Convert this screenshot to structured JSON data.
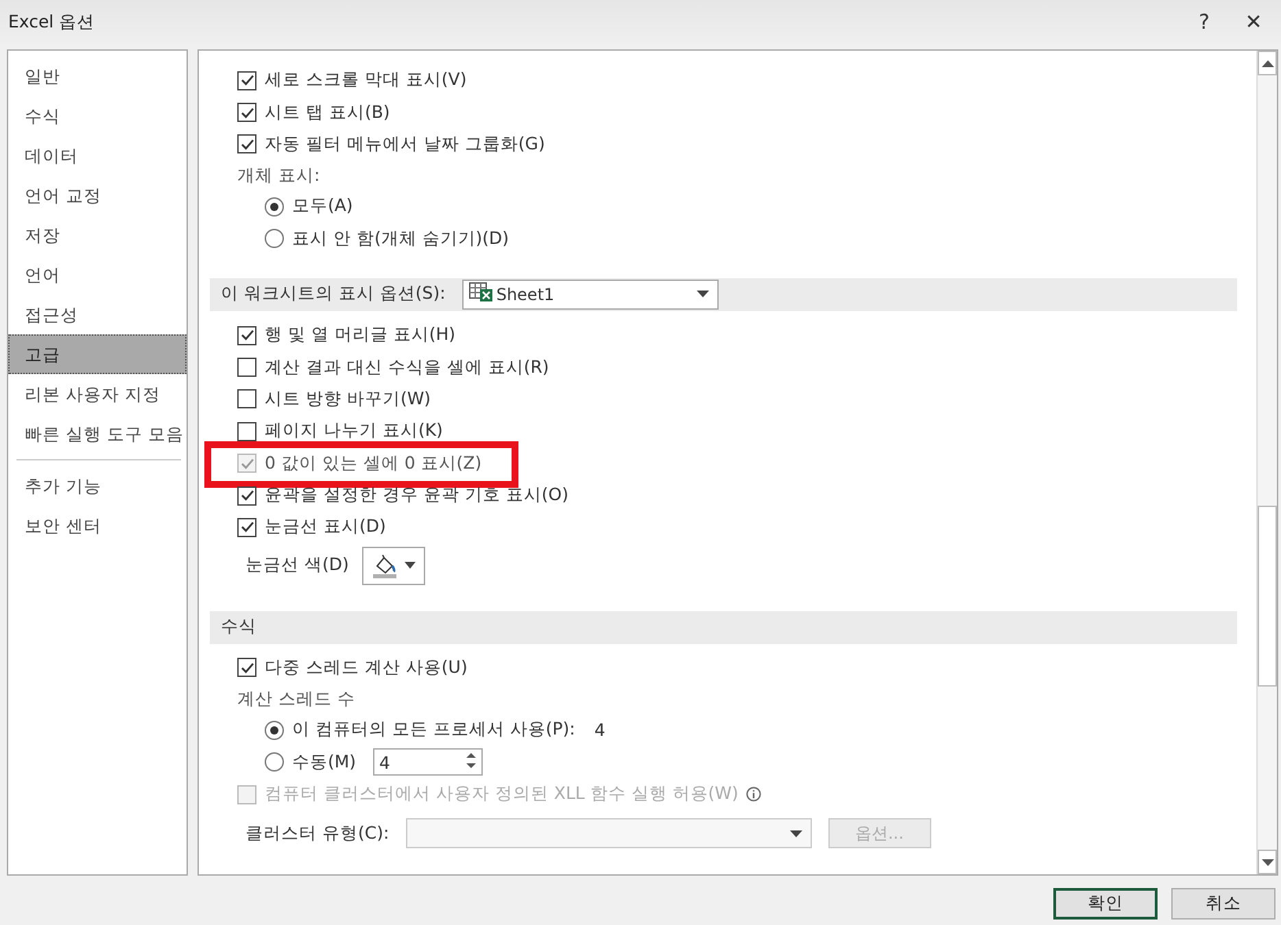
{
  "window": {
    "title": "Excel 옵션",
    "help": "?",
    "close": "✕"
  },
  "sidebar": {
    "items": [
      {
        "label": "일반",
        "selected": false
      },
      {
        "label": "수식",
        "selected": false
      },
      {
        "label": "데이터",
        "selected": false
      },
      {
        "label": "언어 교정",
        "selected": false
      },
      {
        "label": "저장",
        "selected": false
      },
      {
        "label": "언어",
        "selected": false
      },
      {
        "label": "접근성",
        "selected": false
      },
      {
        "label": "고급",
        "selected": true
      },
      {
        "label": "리본 사용자 지정",
        "selected": false,
        "separator_after": false
      },
      {
        "label": "빠른 실행 도구 모음",
        "selected": false,
        "separator_after": true
      },
      {
        "label": "추가 기능",
        "selected": false
      },
      {
        "label": "보안 센터",
        "selected": false
      }
    ]
  },
  "content": {
    "items": [
      {
        "kind": "checkbox",
        "label": "세로 스크롤 막대 표시(V)",
        "checked": true,
        "disabled": false
      },
      {
        "kind": "checkbox",
        "label": "시트 탭 표시(B)",
        "checked": true,
        "disabled": false
      },
      {
        "kind": "checkbox",
        "label": "자동 필터 메뉴에서 날짜 그룹화(G)",
        "checked": true,
        "disabled": false
      },
      {
        "kind": "group",
        "label": "개체 표시:",
        "children": [
          {
            "kind": "radio",
            "label": "모두(A)",
            "selected": true
          },
          {
            "kind": "radio",
            "label": "표시 안 함(개체 숨기기)(D)",
            "selected": false
          }
        ]
      },
      {
        "kind": "section",
        "label": "이 워크시트의 표시 옵션(S):",
        "dropdown": "Sheet1"
      },
      {
        "kind": "checkbox",
        "label": "행 및 열 머리글 표시(H)",
        "checked": true,
        "disabled": false
      },
      {
        "kind": "checkbox",
        "label": "계산 결과 대신 수식을 셀에 표시(R)",
        "checked": false,
        "disabled": false
      },
      {
        "kind": "checkbox",
        "label": "시트 방향 바꾸기(W)",
        "checked": false,
        "disabled": false
      },
      {
        "kind": "checkbox",
        "label": "페이지 나누기 표시(K)",
        "checked": false,
        "disabled": false
      },
      {
        "kind": "checkbox",
        "label": "0 값이 있는 셀에 0 표시(Z)",
        "checked": true,
        "disabled": true,
        "highlighted": true
      },
      {
        "kind": "checkbox",
        "label": "윤곽을 설정한 경우 윤곽 기호 표시(O)",
        "checked": true,
        "disabled": false
      },
      {
        "kind": "checkbox",
        "label": "눈금선 표시(D)",
        "checked": true,
        "disabled": false
      },
      {
        "kind": "color",
        "label": "눈금선 색(D)"
      },
      {
        "kind": "section",
        "label": "수식"
      },
      {
        "kind": "checkbox",
        "label": "다중 스레드 계산 사용(U)",
        "checked": true,
        "disabled": false
      },
      {
        "kind": "group",
        "label": "계산 스레드 수",
        "children": [
          {
            "kind": "radio",
            "label": "이 컴퓨터의 모든 프로세서 사용(P):",
            "selected": true,
            "count": "4"
          },
          {
            "kind": "radio",
            "label": "수동(M)",
            "selected": false,
            "spinner": "4"
          }
        ]
      },
      {
        "kind": "checkbox",
        "label": "컴퓨터 클러스터에서 사용자 정의된 XLL 함수 실행 허용(W)",
        "checked": false,
        "disabled": true,
        "info": true
      },
      {
        "kind": "combo",
        "label": "클러스터 유형(C):",
        "button": "옵션..."
      }
    ]
  },
  "buttons": [
    {
      "label": "확인",
      "default": true
    },
    {
      "label": "취소",
      "default": false
    }
  ]
}
